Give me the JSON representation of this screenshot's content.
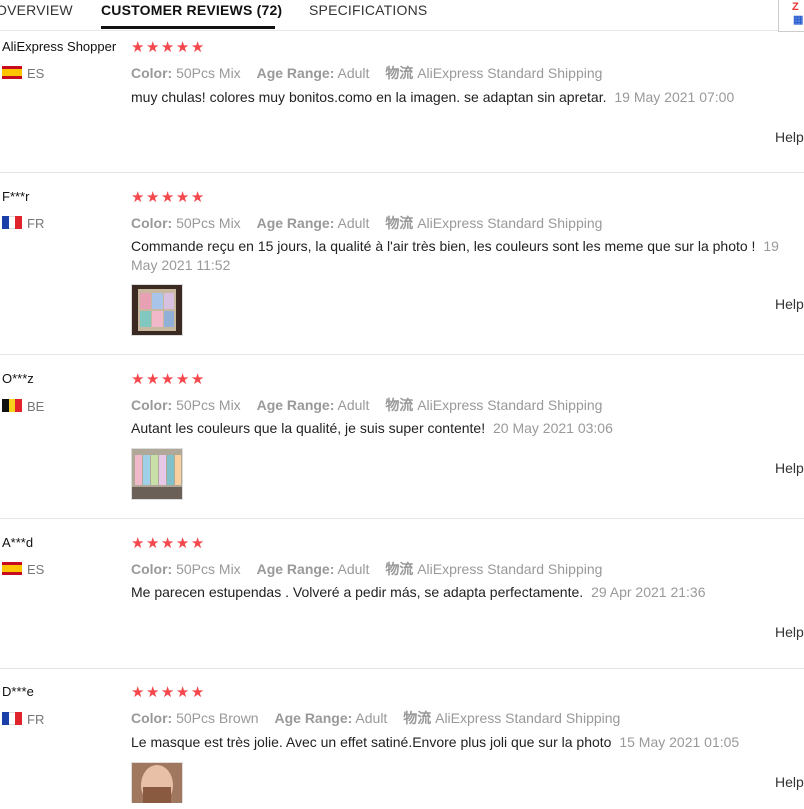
{
  "tabs": {
    "overview": "OVERVIEW",
    "reviews": "CUSTOMER REVIEWS (72)",
    "specs": "SPECIFICATIONS"
  },
  "labels": {
    "color": "Color:",
    "age": "Age Range:",
    "shipping": "物流",
    "help": "Help"
  },
  "rating_max": 5,
  "reviews": [
    {
      "user": "AliExpress Shopper",
      "country": "ES",
      "rating": 5,
      "color": "50Pcs Mix",
      "age": "Adult",
      "shipping": "AliExpress Standard Shipping",
      "text": "muy chulas! colores muy bonitos.como en la imagen. se adaptan sin apretar.",
      "date": "19 May 2021 07:00"
    },
    {
      "user": "F***r",
      "country": "FR",
      "rating": 5,
      "color": "50Pcs Mix",
      "age": "Adult",
      "shipping": "AliExpress Standard Shipping",
      "text": "Commande reçu en 15 jours, la qualité à l'air très bien, les couleurs sont les meme que sur la photo !",
      "date": "19 May 2021 11:52"
    },
    {
      "user": "O***z",
      "country": "BE",
      "rating": 5,
      "color": "50Pcs Mix",
      "age": "Adult",
      "shipping": "AliExpress Standard Shipping",
      "text": "Autant les couleurs que la qualité, je suis super contente!",
      "date": "20 May 2021 03:06"
    },
    {
      "user": "A***d",
      "country": "ES",
      "rating": 5,
      "color": "50Pcs Mix",
      "age": "Adult",
      "shipping": "AliExpress Standard Shipping",
      "text": "Me parecen estupendas . Volveré a pedir más, se adapta perfectamente.",
      "date": "29 Apr 2021 21:36"
    },
    {
      "user": "D***e",
      "country": "FR",
      "rating": 5,
      "color": "50Pcs Brown",
      "age": "Adult",
      "shipping": "AliExpress Standard Shipping",
      "text": "Le masque est très jolie. Avec un effet satiné.Envore plus joli que sur la photo",
      "date": "15 May 2021 01:05"
    }
  ]
}
